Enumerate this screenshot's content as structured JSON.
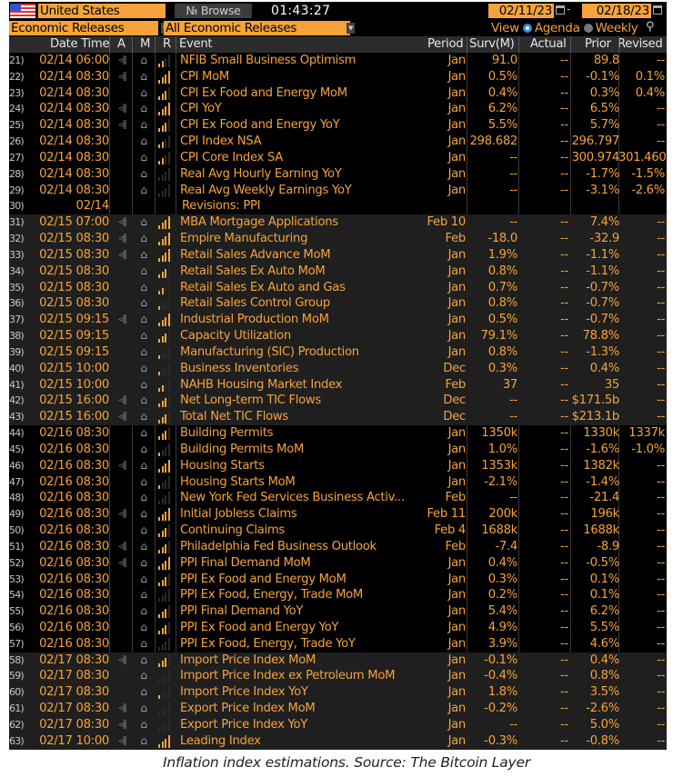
{
  "toolbar": {
    "country": "United States",
    "browse_label": "Browse",
    "clock": "01:43:27",
    "date_from": "02/11/23",
    "date_separator": "-",
    "date_to": "02/18/23",
    "category_select": "Economic Releases",
    "subcategory_select": "All Economic Releases",
    "view_label": "View",
    "view_options": [
      {
        "label": "Agenda",
        "selected": true
      },
      {
        "label": "Weekly",
        "selected": false
      }
    ],
    "accent_color": "#f5a33a"
  },
  "columns": [
    "Date Time",
    "A",
    "M",
    "R",
    "Event",
    "Period",
    "Surv(M)",
    "Actual",
    "Prior",
    "Revised"
  ],
  "rows": [
    {
      "n": "21)",
      "dt": "02/14 06:00",
      "alert": true,
      "rel": 2,
      "ev": "NFIB Small Business Optimism",
      "per": "Jan",
      "surv": "91.0",
      "act": "--",
      "prior": "89.8",
      "rev": "--",
      "group": 0
    },
    {
      "n": "22)",
      "dt": "02/14 08:30",
      "alert": true,
      "rel": 4,
      "ev": "CPI MoM",
      "per": "Jan",
      "surv": "0.5%",
      "act": "--",
      "prior": "-0.1%",
      "rev": "0.1%",
      "group": 0
    },
    {
      "n": "23)",
      "dt": "02/14 08:30",
      "alert": false,
      "rel": 3,
      "ev": "CPI Ex Food and Energy MoM",
      "per": "Jan",
      "surv": "0.4%",
      "act": "--",
      "prior": "0.3%",
      "rev": "0.4%",
      "group": 0
    },
    {
      "n": "24)",
      "dt": "02/14 08:30",
      "alert": true,
      "rel": 4,
      "ev": "CPI YoY",
      "per": "Jan",
      "surv": "6.2%",
      "act": "--",
      "prior": "6.5%",
      "rev": "--",
      "group": 0
    },
    {
      "n": "25)",
      "dt": "02/14 08:30",
      "alert": true,
      "rel": 3,
      "ev": "CPI Ex Food and Energy YoY",
      "per": "Jan",
      "surv": "5.5%",
      "act": "--",
      "prior": "5.7%",
      "rev": "--",
      "group": 0
    },
    {
      "n": "26)",
      "dt": "02/14 08:30",
      "alert": false,
      "rel": 2,
      "ev": "CPI Index NSA",
      "per": "Jan",
      "surv": "298.682",
      "act": "--",
      "prior": "296.797",
      "rev": "--",
      "group": 0
    },
    {
      "n": "27)",
      "dt": "02/14 08:30",
      "alert": false,
      "rel": 2,
      "ev": "CPI Core Index SA",
      "per": "Jan",
      "surv": "--",
      "act": "--",
      "prior": "300.974",
      "rev": "301.460",
      "group": 0
    },
    {
      "n": "28)",
      "dt": "02/14 08:30",
      "alert": false,
      "rel": 0,
      "ev": "Real Avg Hourly Earning YoY",
      "per": "Jan",
      "surv": "--",
      "act": "--",
      "prior": "-1.7%",
      "rev": "-1.5%",
      "group": 0
    },
    {
      "n": "29)",
      "dt": "02/14 08:30",
      "alert": false,
      "rel": 0,
      "ev": "Real Avg Weekly Earnings YoY",
      "per": "Jan",
      "surv": "--",
      "act": "--",
      "prior": "-3.1%",
      "rev": "-2.6%",
      "group": 0
    },
    {
      "n": "30)",
      "dt": "02/14",
      "alert": false,
      "nobell": true,
      "norel": true,
      "ev": "Revisions: PPI",
      "per": "",
      "surv": "",
      "act": "",
      "prior": "",
      "rev": "",
      "group": 0
    },
    {
      "n": "31)",
      "dt": "02/15 07:00",
      "alert": true,
      "rel": 4,
      "ev": "MBA Mortgage Applications",
      "per": "Feb 10",
      "surv": "--",
      "act": "--",
      "prior": "7.4%",
      "rev": "--",
      "group": 1
    },
    {
      "n": "32)",
      "dt": "02/15 08:30",
      "alert": true,
      "rel": 4,
      "ev": "Empire Manufacturing",
      "per": "Feb",
      "surv": "-18.0",
      "act": "--",
      "prior": "-32.9",
      "rev": "--",
      "group": 1
    },
    {
      "n": "33)",
      "dt": "02/15 08:30",
      "alert": true,
      "rel": 4,
      "ev": "Retail Sales Advance MoM",
      "per": "Jan",
      "surv": "1.9%",
      "act": "--",
      "prior": "-1.1%",
      "rev": "--",
      "group": 1
    },
    {
      "n": "34)",
      "dt": "02/15 08:30",
      "alert": false,
      "rel": 3,
      "ev": "Retail Sales Ex Auto MoM",
      "per": "Jan",
      "surv": "0.8%",
      "act": "--",
      "prior": "-1.1%",
      "rev": "--",
      "group": 1
    },
    {
      "n": "35)",
      "dt": "02/15 08:30",
      "alert": false,
      "rel": 2,
      "ev": "Retail Sales Ex Auto and Gas",
      "per": "Jan",
      "surv": "0.7%",
      "act": "--",
      "prior": "-0.7%",
      "rev": "--",
      "group": 1
    },
    {
      "n": "36)",
      "dt": "02/15 08:30",
      "alert": false,
      "rel": 1,
      "ev": "Retail Sales Control Group",
      "per": "Jan",
      "surv": "0.8%",
      "act": "--",
      "prior": "-0.7%",
      "rev": "--",
      "group": 1
    },
    {
      "n": "37)",
      "dt": "02/15 09:15",
      "alert": true,
      "rel": 4,
      "ev": "Industrial Production MoM",
      "per": "Jan",
      "surv": "0.5%",
      "act": "--",
      "prior": "-0.7%",
      "rev": "--",
      "group": 1
    },
    {
      "n": "38)",
      "dt": "02/15 09:15",
      "alert": false,
      "rel": 3,
      "ev": "Capacity Utilization",
      "per": "Jan",
      "surv": "79.1%",
      "act": "--",
      "prior": "78.8%",
      "rev": "--",
      "group": 1
    },
    {
      "n": "39)",
      "dt": "02/15 09:15",
      "alert": false,
      "rel": 1,
      "ev": "Manufacturing (SIC) Production",
      "per": "Jan",
      "surv": "0.8%",
      "act": "--",
      "prior": "-1.3%",
      "rev": "--",
      "group": 1
    },
    {
      "n": "40)",
      "dt": "02/15 10:00",
      "alert": false,
      "rel": 1,
      "ev": "Business Inventories",
      "per": "Dec",
      "surv": "0.3%",
      "act": "--",
      "prior": "0.4%",
      "rev": "--",
      "group": 1
    },
    {
      "n": "41)",
      "dt": "02/15 10:00",
      "alert": false,
      "rel": 2,
      "ev": "NAHB Housing Market Index",
      "per": "Feb",
      "surv": "37",
      "act": "--",
      "prior": "35",
      "rev": "--",
      "group": 1
    },
    {
      "n": "42)",
      "dt": "02/15 16:00",
      "alert": true,
      "rel": 3,
      "ev": "Net Long-term TIC Flows",
      "per": "Dec",
      "surv": "--",
      "act": "--",
      "prior": "$171.5b",
      "rev": "--",
      "group": 1
    },
    {
      "n": "43)",
      "dt": "02/15 16:00",
      "alert": true,
      "rel": 3,
      "ev": "Total Net TIC Flows",
      "per": "Dec",
      "surv": "--",
      "act": "--",
      "prior": "$213.1b",
      "rev": "--",
      "group": 1
    },
    {
      "n": "44)",
      "dt": "02/16 08:30",
      "alert": false,
      "rel": 3,
      "ev": "Building Permits",
      "per": "Jan",
      "surv": "1350k",
      "act": "--",
      "prior": "1330k",
      "rev": "1337k",
      "group": 0
    },
    {
      "n": "45)",
      "dt": "02/16 08:30",
      "alert": false,
      "rel": 1,
      "ev": "Building Permits MoM",
      "per": "Jan",
      "surv": "1.0%",
      "act": "--",
      "prior": "-1.6%",
      "rev": "-1.0%",
      "group": 0
    },
    {
      "n": "46)",
      "dt": "02/16 08:30",
      "alert": true,
      "rel": 4,
      "ev": "Housing Starts",
      "per": "Jan",
      "surv": "1353k",
      "act": "--",
      "prior": "1382k",
      "rev": "--",
      "group": 0
    },
    {
      "n": "47)",
      "dt": "02/16 08:30",
      "alert": false,
      "rel": 1,
      "ev": "Housing Starts MoM",
      "per": "Jan",
      "surv": "-2.1%",
      "act": "--",
      "prior": "-1.4%",
      "rev": "--",
      "group": 0
    },
    {
      "n": "48)",
      "dt": "02/16 08:30",
      "alert": false,
      "rel": 0,
      "ev": "New York Fed Services Business Activ...",
      "per": "Feb",
      "surv": "--",
      "act": "--",
      "prior": "-21.4",
      "rev": "--",
      "group": 0
    },
    {
      "n": "49)",
      "dt": "02/16 08:30",
      "alert": true,
      "rel": 4,
      "ev": "Initial Jobless Claims",
      "per": "Feb 11",
      "surv": "200k",
      "act": "--",
      "prior": "196k",
      "rev": "--",
      "group": 0
    },
    {
      "n": "50)",
      "dt": "02/16 08:30",
      "alert": false,
      "rel": 3,
      "ev": "Continuing Claims",
      "per": "Feb 4",
      "surv": "1688k",
      "act": "--",
      "prior": "1688k",
      "rev": "--",
      "group": 0
    },
    {
      "n": "51)",
      "dt": "02/16 08:30",
      "alert": true,
      "rel": 3,
      "ev": "Philadelphia Fed Business Outlook",
      "per": "Feb",
      "surv": "-7.4",
      "act": "--",
      "prior": "-8.9",
      "rev": "--",
      "group": 0
    },
    {
      "n": "52)",
      "dt": "02/16 08:30",
      "alert": true,
      "rel": 4,
      "ev": "PPI Final Demand MoM",
      "per": "Jan",
      "surv": "0.4%",
      "act": "--",
      "prior": "-0.5%",
      "rev": "--",
      "group": 0
    },
    {
      "n": "53)",
      "dt": "02/16 08:30",
      "alert": false,
      "rel": 3,
      "ev": "PPI Ex Food and Energy MoM",
      "per": "Jan",
      "surv": "0.3%",
      "act": "--",
      "prior": "0.1%",
      "rev": "--",
      "group": 0
    },
    {
      "n": "54)",
      "dt": "02/16 08:30",
      "alert": false,
      "rel": 0,
      "ev": "PPI Ex Food, Energy, Trade MoM",
      "per": "Jan",
      "surv": "0.2%",
      "act": "--",
      "prior": "0.1%",
      "rev": "--",
      "group": 0
    },
    {
      "n": "55)",
      "dt": "02/16 08:30",
      "alert": false,
      "rel": 3,
      "ev": "PPI Final Demand YoY",
      "per": "Jan",
      "surv": "5.4%",
      "act": "--",
      "prior": "6.2%",
      "rev": "--",
      "group": 0
    },
    {
      "n": "56)",
      "dt": "02/16 08:30",
      "alert": false,
      "rel": 3,
      "ev": "PPI Ex Food and Energy YoY",
      "per": "Jan",
      "surv": "4.9%",
      "act": "--",
      "prior": "5.5%",
      "rev": "--",
      "group": 0
    },
    {
      "n": "57)",
      "dt": "02/16 08:30",
      "alert": false,
      "rel": 0,
      "ev": "PPI Ex Food, Energy, Trade YoY",
      "per": "Jan",
      "surv": "3.9%",
      "act": "--",
      "prior": "4.6%",
      "rev": "--",
      "group": 0
    },
    {
      "n": "58)",
      "dt": "02/17 08:30",
      "alert": true,
      "rel": 3,
      "ev": "Import Price Index MoM",
      "per": "Jan",
      "surv": "-0.1%",
      "act": "--",
      "prior": "0.4%",
      "rev": "--",
      "group": 1
    },
    {
      "n": "59)",
      "dt": "02/17 08:30",
      "alert": false,
      "rel": 0,
      "ev": "Import Price Index ex Petroleum MoM",
      "per": "Jan",
      "surv": "-0.4%",
      "act": "--",
      "prior": "0.8%",
      "rev": "--",
      "group": 1
    },
    {
      "n": "60)",
      "dt": "02/17 08:30",
      "alert": false,
      "rel": 1,
      "ev": "Import Price Index YoY",
      "per": "Jan",
      "surv": "1.8%",
      "act": "--",
      "prior": "3.5%",
      "rev": "--",
      "group": 1
    },
    {
      "n": "61)",
      "dt": "02/17 08:30",
      "alert": true,
      "rel": 0,
      "ev": "Export Price Index MoM",
      "per": "Jan",
      "surv": "-0.2%",
      "act": "--",
      "prior": "-2.6%",
      "rev": "--",
      "group": 1
    },
    {
      "n": "62)",
      "dt": "02/17 08:30",
      "alert": true,
      "rel": 0,
      "ev": "Export Price Index YoY",
      "per": "Jan",
      "surv": "--",
      "act": "--",
      "prior": "5.0%",
      "rev": "--",
      "group": 1
    },
    {
      "n": "63)",
      "dt": "02/17 10:00",
      "alert": true,
      "rel": 4,
      "ev": "Leading Index",
      "per": "Jan",
      "surv": "-0.3%",
      "act": "--",
      "prior": "-0.8%",
      "rev": "--",
      "group": 1
    }
  ],
  "icons": {
    "alert": "speaker-icon",
    "bell": "bell-icon",
    "relevance": "signal-bars-icon",
    "calendar": "calendar-icon",
    "search": "zoom-search-icon"
  },
  "caption": "Inflation index estimations. Source: The Bitcoin Layer"
}
